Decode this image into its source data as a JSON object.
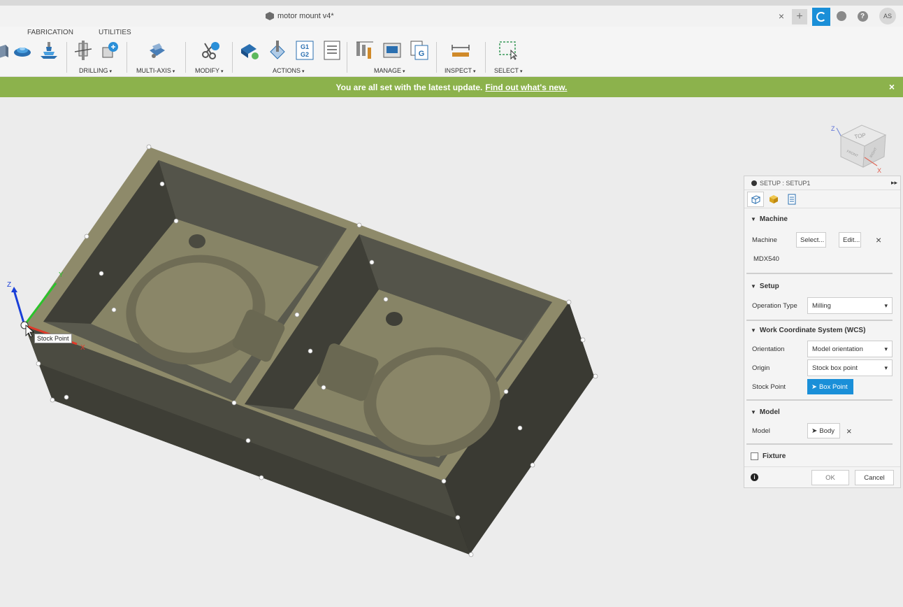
{
  "window": {
    "title": "motor mount v4*",
    "close_tab": "×",
    "new_tab": "+",
    "user_initials": "AS",
    "help_glyph": "?"
  },
  "toolbar": {
    "tabs": [
      "FABRICATION",
      "UTILITIES"
    ],
    "groups": {
      "drilling": "DRILLING",
      "multi_axis": "MULTI-AXIS",
      "modify": "MODIFY",
      "actions": "ACTIONS",
      "manage": "MANAGE",
      "inspect": "INSPECT",
      "select": "SELECT"
    },
    "g_code_icon": "G1\nG2",
    "post_icon_letter": "G"
  },
  "banner": {
    "text": "You are all set with the latest update.",
    "link": "Find out what's new.",
    "close": "×",
    "color": "#8cb24c"
  },
  "viewport": {
    "stock_point_tooltip": "Stock Point",
    "axis_labels": {
      "z": "Z",
      "y": "Y",
      "x": "X"
    },
    "viewcube": {
      "top": "TOP",
      "front": "FRONT",
      "right": "RIGHT",
      "z": "Z",
      "x": "X"
    }
  },
  "panel": {
    "title": "SETUP : SETUP1",
    "expand": "▸▸",
    "sections": {
      "machine": {
        "title": "Machine",
        "label": "Machine",
        "select_button": "Select...",
        "edit_button": "Edit...",
        "clear": "×",
        "machine_name": "MDX540"
      },
      "setup": {
        "title": "Setup",
        "operation_type_label": "Operation Type",
        "operation_type_value": "Milling"
      },
      "wcs": {
        "title": "Work Coordinate System (WCS)",
        "orientation_label": "Orientation",
        "orientation_value": "Model orientation",
        "origin_label": "Origin",
        "origin_value": "Stock box point",
        "stock_point_label": "Stock Point",
        "stock_point_value": "Box Point"
      },
      "model": {
        "title": "Model",
        "label": "Model",
        "value": "Body",
        "clear": "×"
      },
      "fixture": {
        "title": "Fixture",
        "checked": false
      }
    },
    "footer": {
      "info": "i",
      "ok": "OK",
      "cancel": "Cancel"
    },
    "accent_color": "#1a8fd8"
  }
}
